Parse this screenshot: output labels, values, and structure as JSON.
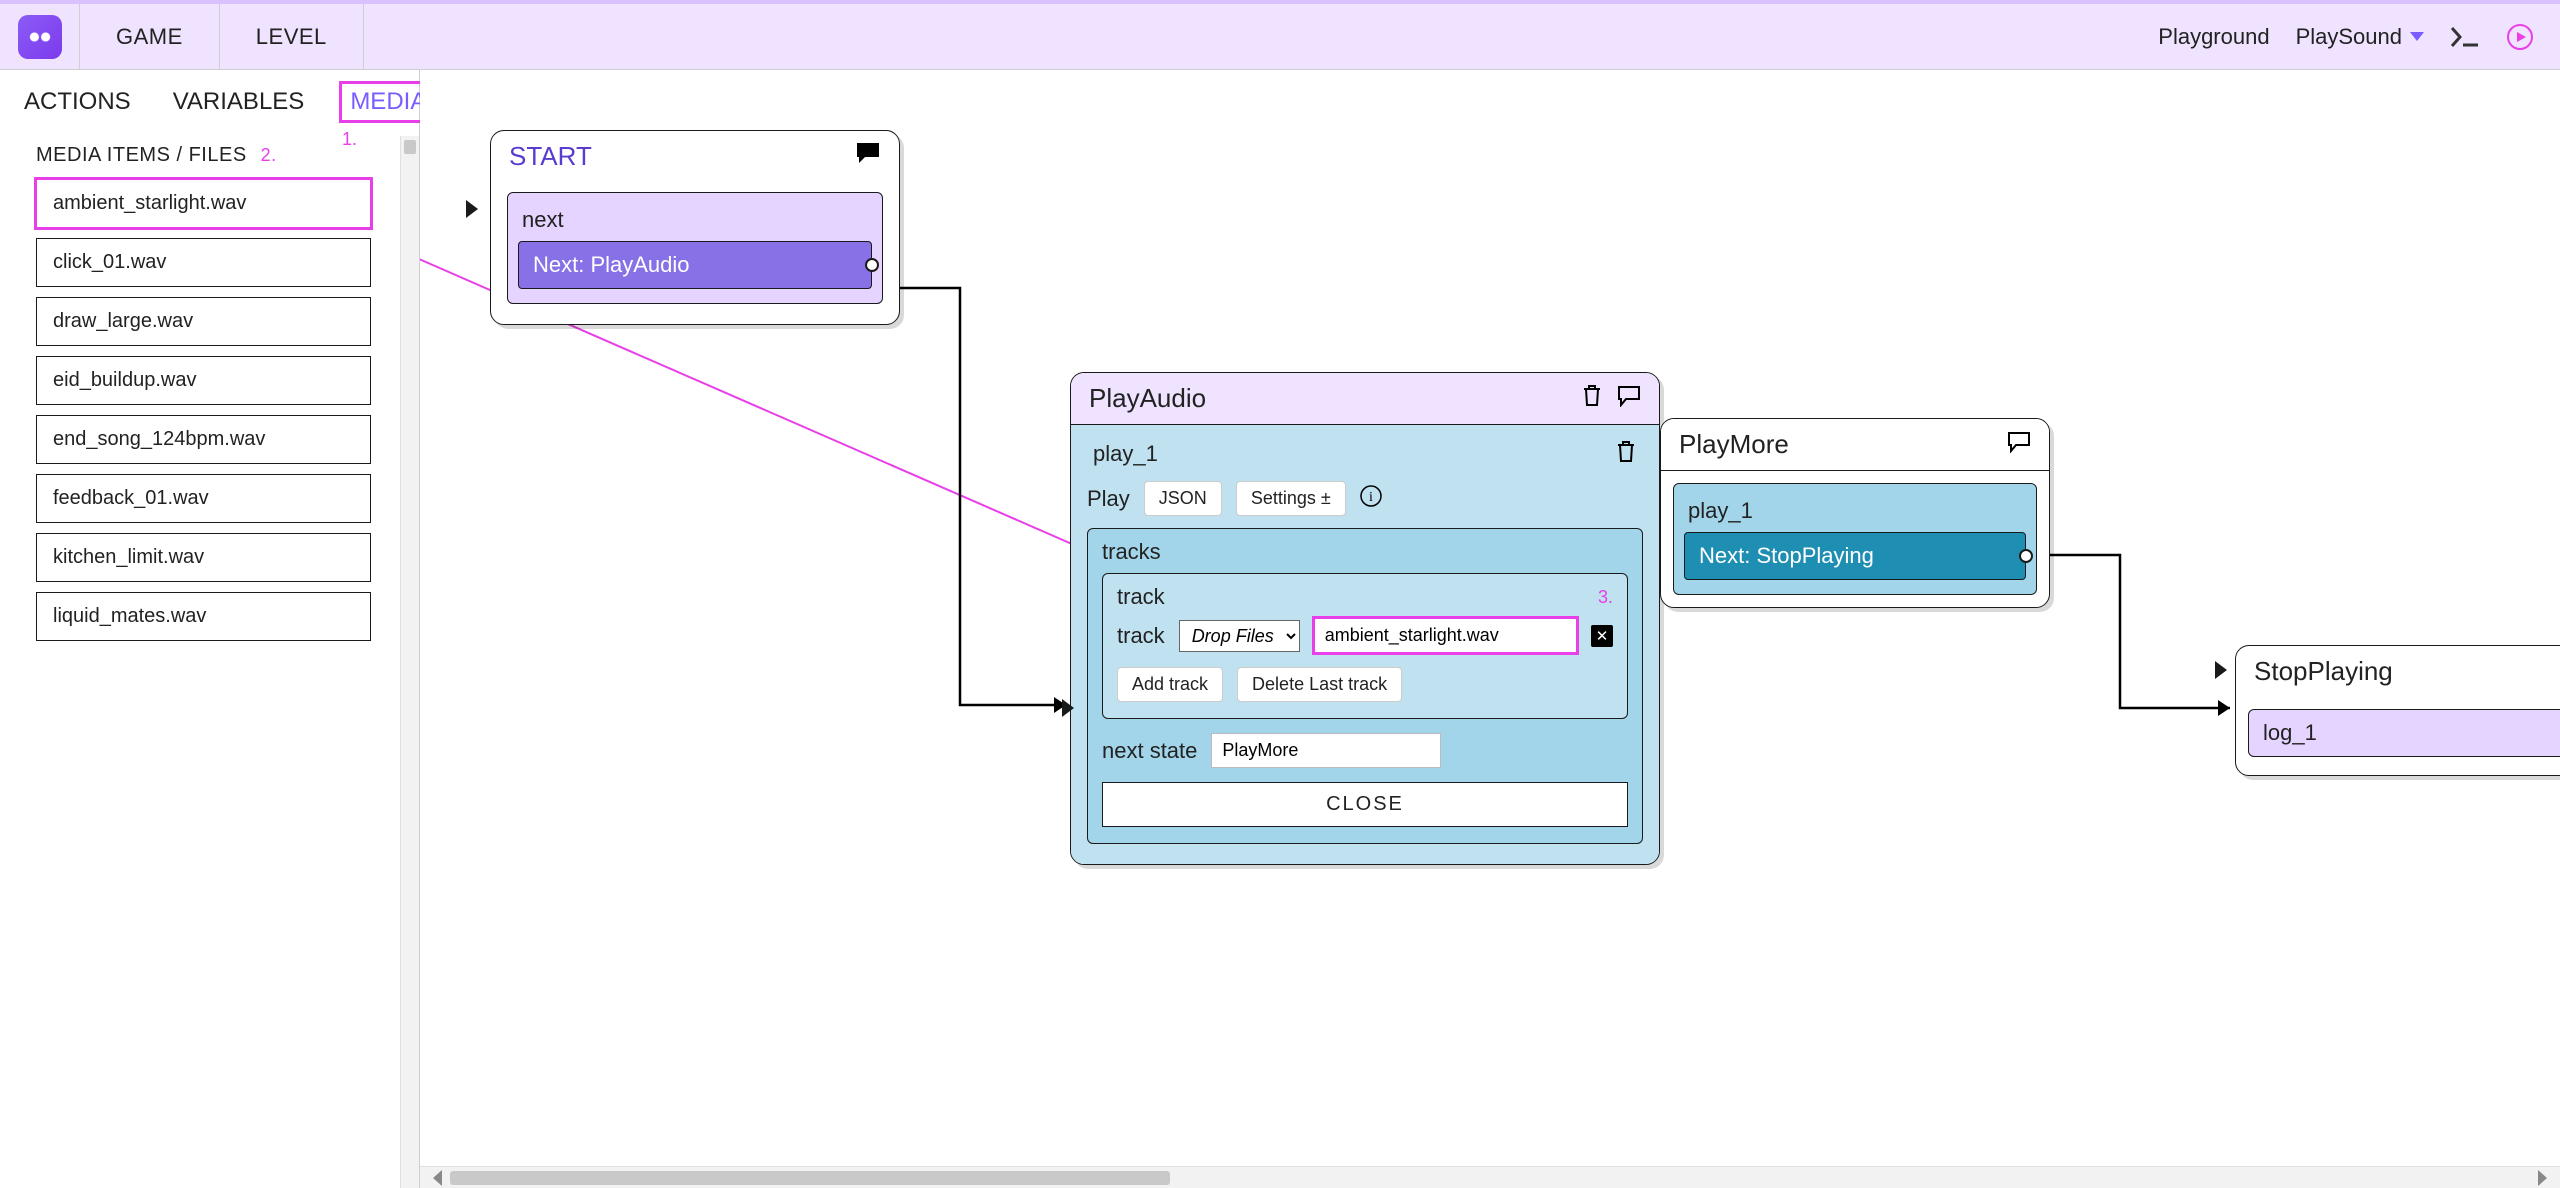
{
  "menubar": {
    "items": [
      "GAME",
      "LEVEL"
    ],
    "breadcrumb": [
      "Playground",
      "PlaySound"
    ]
  },
  "sidebar": {
    "tabs": [
      "ACTIONS",
      "VARIABLES",
      "MEDIA"
    ],
    "section_header": "MEDIA ITEMS / FILES",
    "media_items": [
      "ambient_starlight.wav",
      "click_01.wav",
      "draw_large.wav",
      "eid_buildup.wav",
      "end_song_124bpm.wav",
      "feedback_01.wav",
      "kitchen_limit.wav",
      "liquid_mates.wav"
    ]
  },
  "annotations": {
    "one": "1.",
    "two": "2.",
    "three": "3."
  },
  "nodes": {
    "start": {
      "title": "START",
      "sub_label": "next",
      "next_label": "Next: PlayAudio"
    },
    "play_audio": {
      "title": "PlayAudio",
      "instance": "play_1",
      "mode_label": "Play",
      "json_btn": "JSON",
      "settings_btn": "Settings ±",
      "tracks_label": "tracks",
      "track_label_1": "track",
      "track_label_2": "track",
      "drop_placeholder": "Drop Files",
      "track_value": "ambient_starlight.wav",
      "add_track": "Add track",
      "delete_track": "Delete Last track",
      "next_state_label": "next state",
      "next_state_value": "PlayMore",
      "close": "CLOSE"
    },
    "play_more": {
      "title": "PlayMore",
      "instance": "play_1",
      "next_label": "Next: StopPlaying"
    },
    "stop_playing": {
      "title": "StopPlaying",
      "instance": "log_1"
    }
  }
}
